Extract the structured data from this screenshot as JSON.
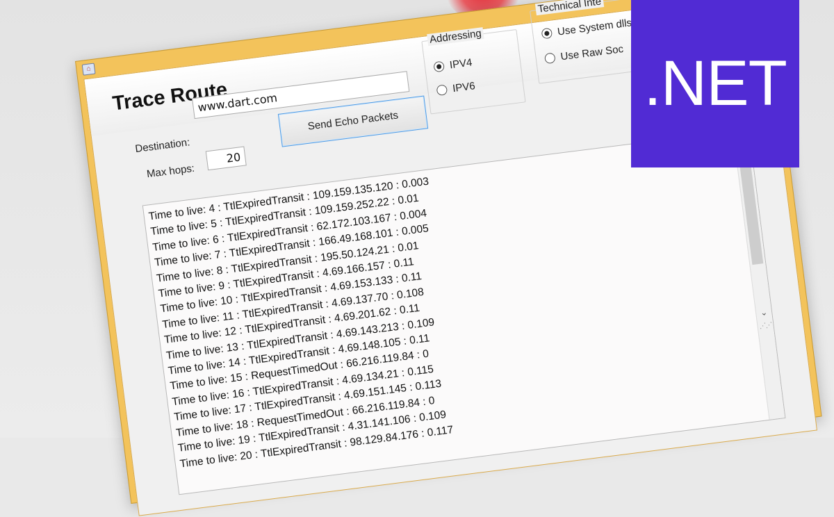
{
  "app": {
    "title": "Trace Route",
    "window_icon": "app-window-icon"
  },
  "form": {
    "destination_label": "Destination:",
    "destination_value": "www.dart.com",
    "max_hops_label": "Max hops:",
    "max_hops_value": "20",
    "send_button_label": "Send Echo Packets"
  },
  "addressing": {
    "title": "Addressing",
    "options": [
      {
        "label": "IPV4",
        "selected": true
      },
      {
        "label": "IPV6",
        "selected": false
      }
    ]
  },
  "technical": {
    "title": "Technical Inte",
    "options": [
      {
        "label": "Use System dlls",
        "selected": true
      },
      {
        "label": "Use Raw Soc",
        "selected": false
      }
    ]
  },
  "output": {
    "lines": [
      "Time to live: 4 : TtlExpiredTransit : 109.159.135.120 : 0.003",
      "Time to live: 5 : TtlExpiredTransit : 109.159.252.22 : 0.01",
      "Time to live: 6 : TtlExpiredTransit : 62.172.103.167 : 0.004",
      "Time to live: 7 : TtlExpiredTransit : 166.49.168.101 : 0.005",
      "Time to live: 8 : TtlExpiredTransit : 195.50.124.21 : 0.01",
      "Time to live: 9 : TtlExpiredTransit : 4.69.166.157 : 0.11",
      "Time to live: 10 : TtlExpiredTransit : 4.69.153.133 : 0.11",
      "Time to live: 11 : TtlExpiredTransit : 4.69.137.70 : 0.108",
      "Time to live: 12 : TtlExpiredTransit : 4.69.201.62 : 0.11",
      "Time to live: 13 : TtlExpiredTransit : 4.69.143.213 : 0.109",
      "Time to live: 14 : TtlExpiredTransit : 4.69.148.105 : 0.11",
      "Time to live: 15 : RequestTimedOut : 66.216.119.84 : 0",
      "Time to live: 16 : TtlExpiredTransit : 4.69.134.21 : 0.115",
      "Time to live: 17 : TtlExpiredTransit : 4.69.151.145 : 0.113",
      "Time to live: 18 : RequestTimedOut : 66.216.119.84 : 0",
      "Time to live: 19 : TtlExpiredTransit : 4.31.141.106 : 0.109",
      "Time to live: 20 : TtlExpiredTransit : 98.129.84.176 : 0.117"
    ]
  },
  "badge": {
    "text": ".NET",
    "color": "#512bd4"
  },
  "colors": {
    "window_frame": "#f3c35b",
    "button_border": "#4d9be6"
  }
}
